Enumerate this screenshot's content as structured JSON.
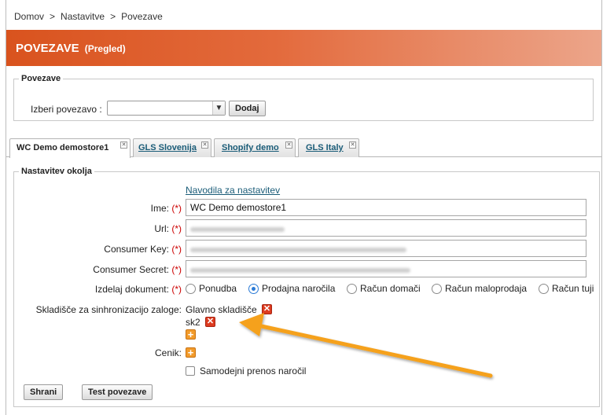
{
  "breadcrumb": {
    "home": "Domov",
    "settings": "Nastavitve",
    "current": "Povezave",
    "separator": ">"
  },
  "header": {
    "title": "POVEZAVE",
    "subtitle": "(Pregled)"
  },
  "add_panel": {
    "legend": "Povezave",
    "select_label": "Izberi povezavo :",
    "select_value": "",
    "add_button": "Dodaj"
  },
  "tabs": [
    {
      "label": "WC Demo demostore1",
      "active": true
    },
    {
      "label": "GLS Slovenija",
      "active": false
    },
    {
      "label": "Shopify demo",
      "active": false
    },
    {
      "label": "GLS Italy",
      "active": false
    }
  ],
  "environment": {
    "legend": "Nastavitev okolja",
    "help_link": "Navodila za nastavitev",
    "required_mark": "(*)",
    "fields": {
      "name": {
        "label": "Ime:",
        "value": "WC Demo demostore1"
      },
      "url": {
        "label": "Url:"
      },
      "consumer_key": {
        "label": "Consumer Key:"
      },
      "consumer_secret": {
        "label": "Consumer Secret:"
      }
    },
    "document": {
      "label": "Izdelaj dokument:",
      "options": [
        "Ponudba",
        "Prodajna naročila",
        "Račun domači",
        "Račun maloprodaja",
        "Račun tuji"
      ],
      "selected": "Prodajna naročila"
    },
    "warehouse": {
      "label": "Skladišče za sinhronizacijo zaloge:",
      "items": [
        "Glavno skladišče",
        "sk2"
      ]
    },
    "pricelist": {
      "label": "Cenik:"
    },
    "auto_transfer": {
      "label": "Samodejni prenos naročil",
      "checked": false
    },
    "save_button": "Shrani",
    "test_button": "Test povezave"
  },
  "icons": {
    "tab_close": "close-icon",
    "remove": "remove-icon",
    "add": "add-icon",
    "dropdown": "chevron-down-icon"
  },
  "colors": {
    "header_start": "#d9531e",
    "header_end": "#eca58a",
    "link": "#1a5c78",
    "required": "#cc0000",
    "annotation_arrow": "#f5a11c"
  }
}
